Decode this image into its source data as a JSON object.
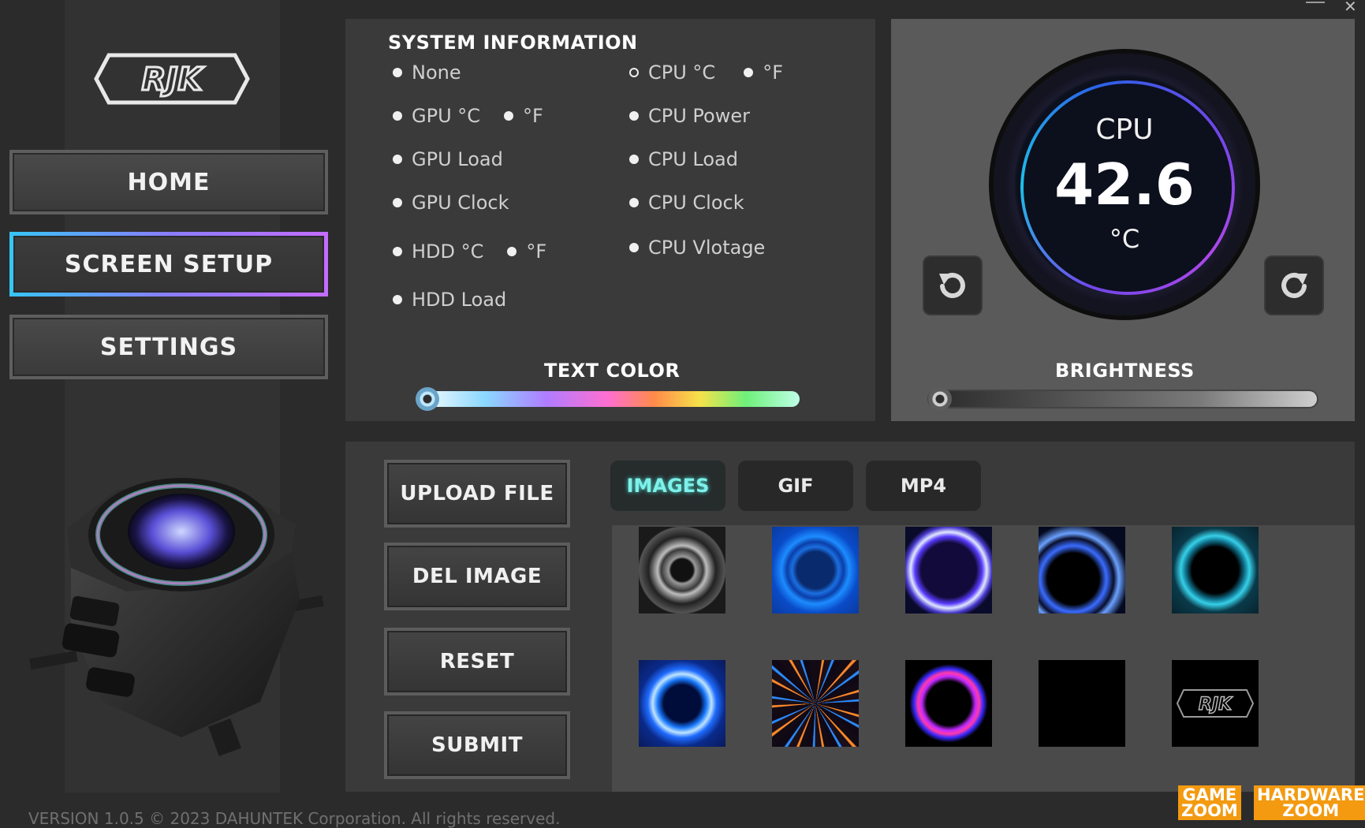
{
  "brand": {
    "logo_text": "RJK"
  },
  "nav": {
    "home": "HOME",
    "screen_setup": "SCREEN SETUP",
    "settings": "SETTINGS",
    "active": "screen_setup"
  },
  "system_info": {
    "title": "SYSTEM INFORMATION",
    "left_options": [
      {
        "label": "None",
        "unit_alt": ""
      },
      {
        "label": "GPU °C",
        "unit_alt": "°F"
      },
      {
        "label": "GPU Load",
        "unit_alt": ""
      },
      {
        "label": "GPU Clock",
        "unit_alt": ""
      },
      {
        "label": "HDD °C",
        "unit_alt": "°F"
      },
      {
        "label": "HDD Load",
        "unit_alt": ""
      }
    ],
    "right_options": [
      {
        "label": "CPU °C",
        "unit_alt": "°F"
      },
      {
        "label": "CPU Power",
        "unit_alt": ""
      },
      {
        "label": "CPU Load",
        "unit_alt": ""
      },
      {
        "label": "CPU Clock",
        "unit_alt": ""
      },
      {
        "label": "CPU Vlotage",
        "unit_alt": ""
      }
    ],
    "selected": "CPU °C",
    "text_color_label": "TEXT COLOR",
    "text_color_level": 0.0
  },
  "preview": {
    "label": "CPU",
    "value": "42.6",
    "unit": "°C",
    "brightness_label": "BRIGHTNESS",
    "brightness_level": 0.0
  },
  "actions": {
    "upload": "UPLOAD FILE",
    "delete": "DEL IMAGE",
    "reset": "RESET",
    "submit": "SUBMIT"
  },
  "media_tabs": {
    "images": "IMAGES",
    "gif": "GIF",
    "mp4": "MP4",
    "active": "images"
  },
  "gallery": {
    "logo_thumb_text": "RJK"
  },
  "footer": "VERSION 1.0.5 © 2023 DAHUNTEK Corporation. All rights reserved.",
  "watermarks": {
    "game": "GAME",
    "zoom1": "ZOOM",
    "hardware": "HARDWARE",
    "zoom2": "ZOOM"
  },
  "colors": {
    "accent_gradient_start": "#36c6f4",
    "accent_gradient_end": "#c46cff",
    "active_tab_text": "#7ff0ea"
  }
}
